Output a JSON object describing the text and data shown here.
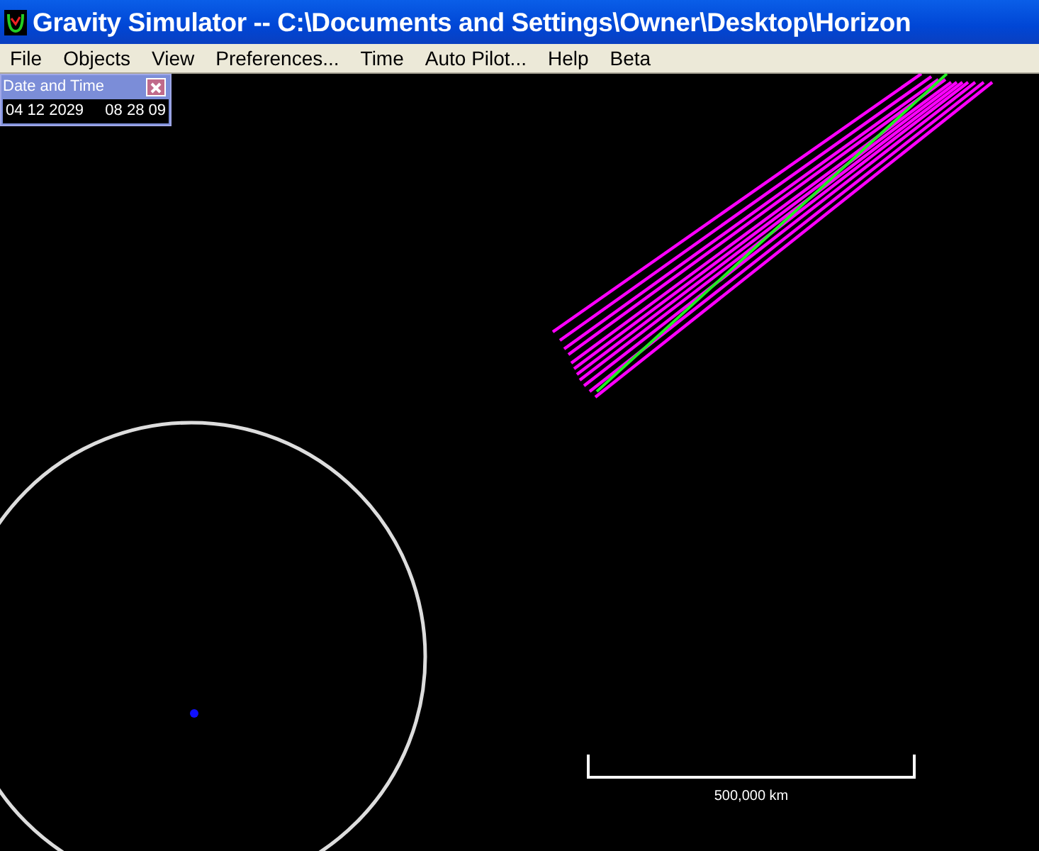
{
  "window": {
    "title": "Gravity Simulator -- C:\\Documents and Settings\\Owner\\Desktop\\Horizon"
  },
  "menu": [
    "File",
    "Objects",
    "View",
    "Preferences...",
    "Time",
    "Auto Pilot...",
    "Help",
    "Beta"
  ],
  "date_window": {
    "title": "Date and Time",
    "date": "04 12 2029",
    "time": "08 28 09"
  },
  "scale_bar": {
    "label": "500,000  km"
  }
}
